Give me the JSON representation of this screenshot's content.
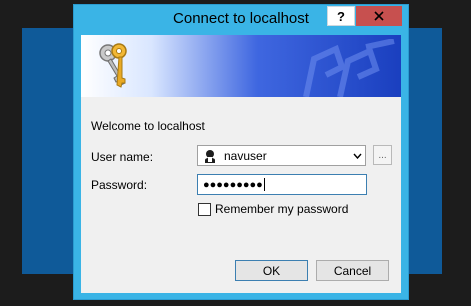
{
  "window": {
    "title": "Connect to localhost",
    "help_label": "?",
    "close_label": "✕"
  },
  "form": {
    "welcome": "Welcome to localhost",
    "username_label": "User name:",
    "username_value": "navuser",
    "browse_label": "...",
    "password_label": "Password:",
    "password_value": "●●●●●●●●●",
    "remember_label": "Remember my password",
    "remember_checked": false
  },
  "buttons": {
    "ok": "OK",
    "cancel": "Cancel"
  },
  "colors": {
    "frame": "#3ab4e6",
    "close": "#c7504f",
    "background_window": "#0f5a99",
    "desktop": "#1c1c1c",
    "banner_dark": "#1a3fbf"
  },
  "icons": [
    "keys-icon",
    "user-avatar-icon",
    "chevron-down-icon",
    "close-icon",
    "help-icon"
  ]
}
